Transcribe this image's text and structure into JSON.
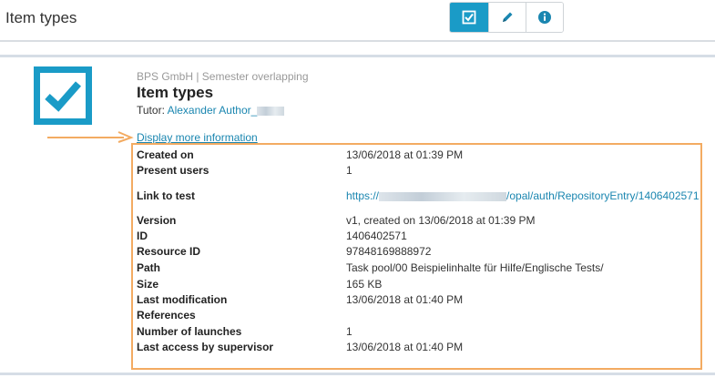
{
  "header": {
    "title": "Item types",
    "toolbar": {
      "buttons": [
        {
          "name": "checkbox-view-button",
          "icon": "checkbox-icon",
          "active": true
        },
        {
          "name": "edit-button",
          "icon": "pencil-icon",
          "active": false
        },
        {
          "name": "info-button",
          "icon": "info-icon",
          "active": false
        }
      ]
    }
  },
  "repo": {
    "org": "BPS GmbH | Semester overlapping",
    "title": "Item types",
    "tutor_label": "Tutor:",
    "tutor_name": "Alexander Author_",
    "more_link": "Display more information"
  },
  "details": {
    "created_on_label": "Created on",
    "created_on": "13/06/2018 at 01:39 PM",
    "present_users_label": "Present users",
    "present_users": "1",
    "link_label": "Link to test",
    "link_prefix": "https://",
    "link_suffix": "/opal/auth/RepositoryEntry/1406402571",
    "version_label": "Version",
    "version": "v1, created on 13/06/2018 at 01:39 PM",
    "id_label": "ID",
    "id": "1406402571",
    "resource_id_label": "Resource ID",
    "resource_id": "97848169888972",
    "path_label": "Path",
    "path": "Task pool/00 Beispielinhalte für Hilfe/Englische Tests/",
    "size_label": "Size",
    "size": "165 KB",
    "last_mod_label": "Last modification",
    "last_mod": "13/06/2018 at 01:40 PM",
    "references_label": "References",
    "launches_label": "Number of launches",
    "launches": "1",
    "last_access_label": "Last access by supervisor",
    "last_access": "13/06/2018 at 01:40 PM"
  },
  "colors": {
    "accent": "#1a9bc7",
    "link": "#1a86b0",
    "highlight": "#f3ab62"
  }
}
